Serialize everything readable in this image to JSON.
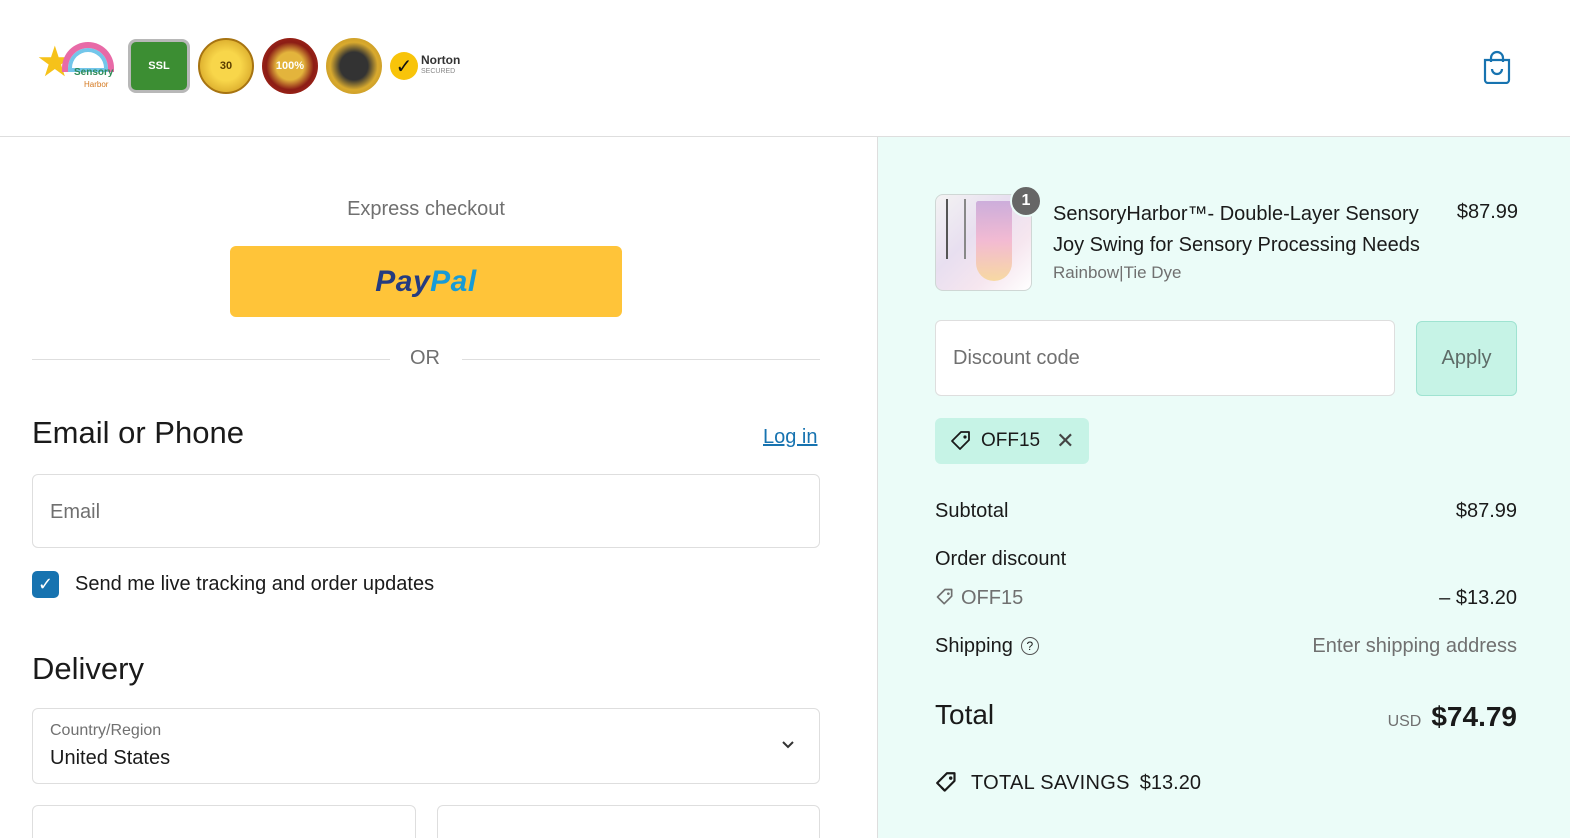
{
  "header": {
    "logo_text": "Sensory",
    "logo_sub": "Harbor",
    "badges": [
      {
        "name": "ssl-badge",
        "text": "SSL"
      },
      {
        "name": "guarantee-badge",
        "text": "30"
      },
      {
        "name": "guaranteed-badge",
        "text": "100%"
      },
      {
        "name": "secure-badge",
        "text": ""
      },
      {
        "name": "norton-badge",
        "text": "Norton",
        "sub": "SECURED"
      }
    ]
  },
  "express": {
    "title": "Express checkout",
    "paypal_a": "Pay",
    "paypal_b": "Pal",
    "or_label": "OR"
  },
  "contact": {
    "heading": "Email or Phone",
    "login_label": "Log in",
    "email_placeholder": "Email",
    "checkbox_checked": true,
    "checkbox_label": "Send me live tracking and order updates"
  },
  "delivery": {
    "heading": "Delivery",
    "country_label": "Country/Region",
    "country_value": "United States"
  },
  "summary": {
    "product": {
      "quantity": "1",
      "title": "SensoryHarbor™- Double-Layer Sensory Joy Swing for Sensory Processing Needs",
      "variant": "Rainbow|Tie Dye",
      "price": "$87.99"
    },
    "discount_placeholder": "Discount code",
    "apply_label": "Apply",
    "applied_code": "OFF15",
    "subtotal_label": "Subtotal",
    "subtotal_value": "$87.99",
    "order_discount_label": "Order discount",
    "order_discount_code": "OFF15",
    "order_discount_value": "– $13.20",
    "shipping_label": "Shipping",
    "shipping_value": "Enter shipping address",
    "total_label": "Total",
    "total_currency": "USD",
    "total_value": "$74.79",
    "savings_label": "TOTAL SAVINGS",
    "savings_value": "$13.20"
  },
  "colors": {
    "accent": "#1773b0",
    "paypal_yellow": "#ffc439",
    "summary_bg": "#ebfcf8",
    "chip_bg": "#c6f3e6"
  }
}
